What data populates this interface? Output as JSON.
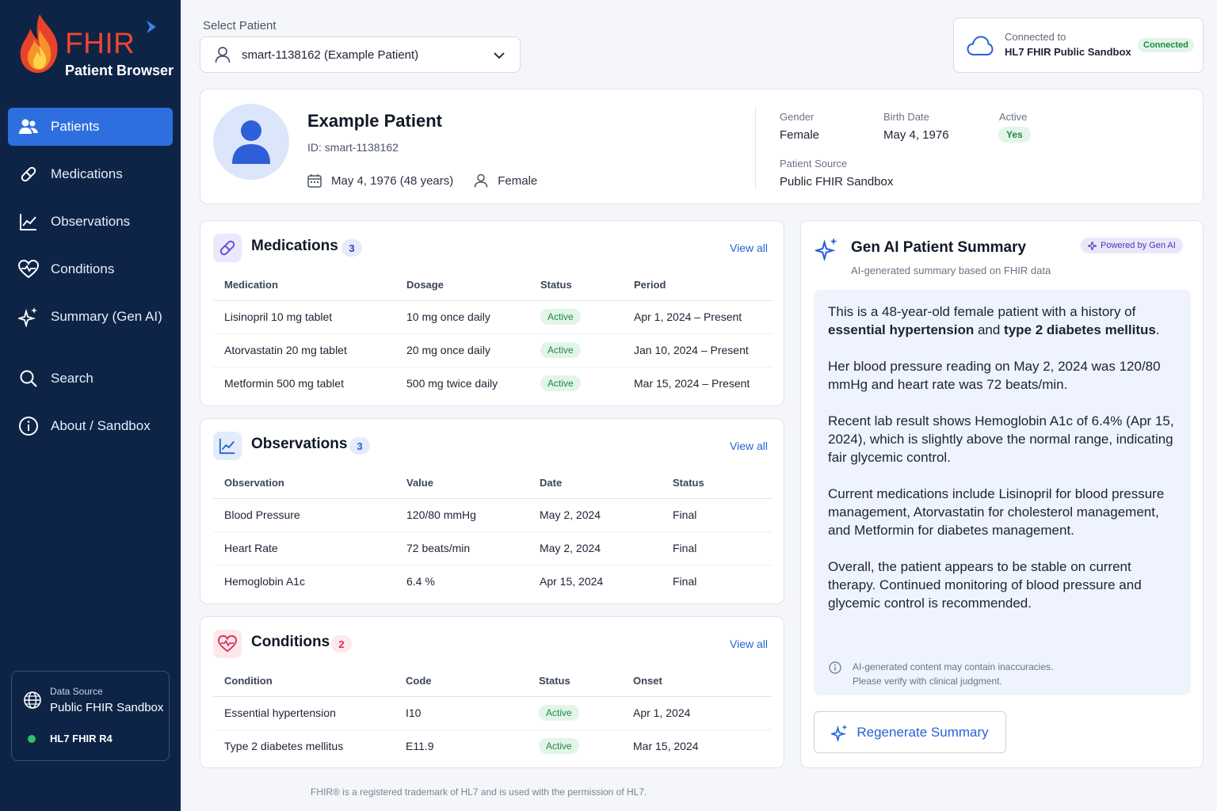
{
  "brand": {
    "name": "FHIR",
    "subtitle": "Patient Browser"
  },
  "sidebar": {
    "items": [
      {
        "label": "Patients",
        "icon": "users-icon",
        "active": true
      },
      {
        "label": "Medications",
        "icon": "pill-icon"
      },
      {
        "label": "Observations",
        "icon": "chart-line-icon"
      },
      {
        "label": "Conditions",
        "icon": "heart-pulse-icon"
      },
      {
        "label": "Summary (Gen AI)",
        "icon": "sparkles-icon"
      },
      {
        "label": "Search",
        "icon": "search-icon"
      },
      {
        "label": "About / Sandbox",
        "icon": "info-icon"
      }
    ],
    "data_source": {
      "label": "Data Source",
      "value": "Public FHIR Sandbox",
      "version": "HL7 FHIR R4"
    }
  },
  "patient_select": {
    "label": "Select Patient",
    "value": "smart-1138162 (Example Patient)"
  },
  "connection": {
    "label": "Connected to",
    "server": "HL7 FHIR Public Sandbox",
    "status": "Connected"
  },
  "patient": {
    "name": "Example Patient",
    "id": "ID: smart-1138162",
    "dob_age": "May 4, 1976 (48 years)",
    "gender": "Female",
    "fields": {
      "gender_label": "Gender",
      "gender_value": "Female",
      "birth_label": "Birth Date",
      "birth_value": "May 4, 1976",
      "active_label": "Active",
      "active_value": "Yes",
      "source_label": "Patient Source",
      "source_value": "Public FHIR Sandbox"
    }
  },
  "medications": {
    "title": "Medications",
    "count": "3",
    "view_all": "View all",
    "headers": [
      "Medication",
      "Dosage",
      "Status",
      "Period"
    ],
    "rows": [
      [
        "Lisinopril 10 mg tablet",
        "10 mg once daily",
        "Active",
        "Apr 1, 2024 – Present"
      ],
      [
        "Atorvastatin 20 mg tablet",
        "20 mg once daily",
        "Active",
        "Jan 10, 2024 – Present"
      ],
      [
        "Metformin 500 mg tablet",
        "500 mg twice daily",
        "Active",
        "Mar 15, 2024 – Present"
      ]
    ]
  },
  "observations": {
    "title": "Observations",
    "count": "3",
    "view_all": "View all",
    "headers": [
      "Observation",
      "Value",
      "Date",
      "Status"
    ],
    "rows": [
      [
        "Blood Pressure",
        "120/80 mmHg",
        "May 2, 2024",
        "Final"
      ],
      [
        "Heart Rate",
        "72 beats/min",
        "May 2, 2024",
        "Final"
      ],
      [
        "Hemoglobin A1c",
        "6.4 %",
        "Apr 15, 2024",
        "Final"
      ]
    ]
  },
  "conditions": {
    "title": "Conditions",
    "count": "2",
    "view_all": "View all",
    "headers": [
      "Condition",
      "Code",
      "Status",
      "Onset"
    ],
    "rows": [
      [
        "Essential hypertension",
        "I10",
        "Active",
        "Apr 1, 2024"
      ],
      [
        "Type 2 diabetes mellitus",
        "E11.9",
        "Active",
        "Mar 15, 2024"
      ]
    ]
  },
  "ai_summary": {
    "title": "Gen AI Patient Summary",
    "subtitle": "AI-generated summary based on FHIR data",
    "powered": "Powered by Gen AI",
    "p1_a": "This is a 48-year-old female patient with a history of ",
    "p1_b": "essential hypertension",
    "p1_c": " and ",
    "p1_d": "type 2 diabetes mellitus",
    "p1_e": ".",
    "p2": "Her blood pressure reading on May 2, 2024 was 120/80 mmHg and heart rate was 72 beats/min.",
    "p3": "Recent lab result shows Hemoglobin A1c of 6.4% (Apr 15, 2024), which is slightly above the normal range, indicating fair glycemic control.",
    "p4": "Current medications include Lisinopril for blood pressure management, Atorvastatin for cholesterol management, and Metformin for diabetes management.",
    "p5": "Overall, the patient appears to be stable on current therapy. Continued monitoring of blood pressure and glycemic control is recommended.",
    "note_1": "AI-generated content may contain inaccuracies.",
    "note_2": "Please verify with clinical judgment.",
    "button": "Regenerate Summary"
  },
  "footer": "FHIR® is a registered trademark of HL7 and is used with the permission of HL7.",
  "colors": {
    "sidebar": "#0d2447",
    "accent": "#2e6fe0",
    "brand_red": "#f0442f",
    "active_green": "#1e8a47"
  }
}
